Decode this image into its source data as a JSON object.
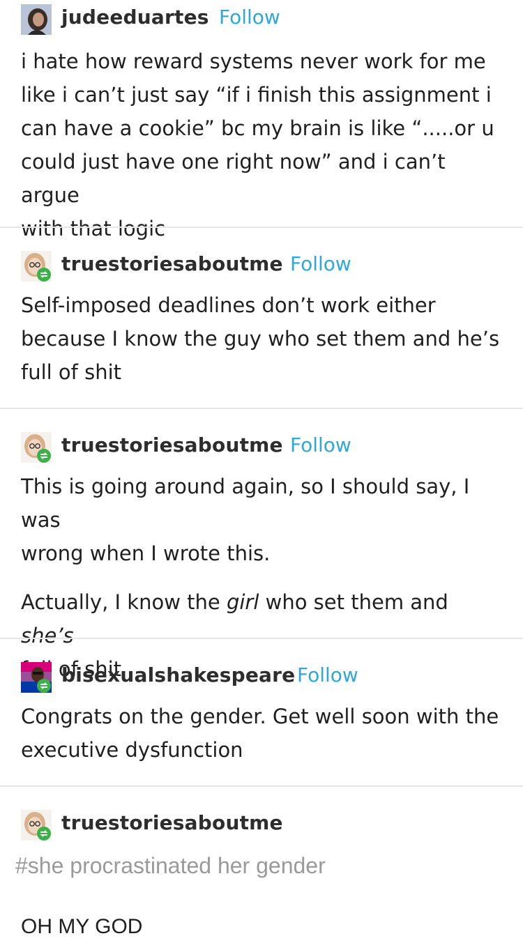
{
  "posts": [
    {
      "username": "judeeduartes",
      "follow_label": "Follow",
      "paragraphs": [
        "i hate how reward systems never work for me like i can’t just say “if i finish this assignment i can have a cookie” bc my brain is like “.....or u could just have one right now” and i can’t argue with that logic"
      ],
      "lines": [
        "i hate how reward systems never work for me",
        "like i can’t just say “if i finish this assignment i",
        "can have a cookie” bc my brain is like “.....or u",
        "could just have one right now” and i can’t argue",
        "with that logic"
      ]
    },
    {
      "username": "truestoriesaboutme",
      "follow_label": "Follow",
      "lines": [
        "Self-imposed deadlines don’t work either",
        "because I know the guy who set them and he’s",
        "full of shit"
      ]
    },
    {
      "username": "truestoriesaboutme",
      "follow_label": "Follow",
      "lines_a": [
        "This is going around again, so I should say, I was",
        "wrong when I wrote this."
      ],
      "line_b1_pre": "Actually, I know the ",
      "line_b1_em1": "girl",
      "line_b1_mid": " who set them and ",
      "line_b1_em2": "she’s",
      "line_b2": "full of shit"
    },
    {
      "username": "bisexualshakespeare",
      "follow_label": "Follow",
      "lines": [
        "Congrats on the gender. Get well soon with the",
        "executive dysfunction"
      ]
    },
    {
      "username": "truestoriesaboutme",
      "tag": "#she procrastinated her gender",
      "text": "OH MY GOD"
    }
  ],
  "colors": {
    "follow": "#2fa8d8",
    "divider": "#e6e6e6",
    "tag": "#9a9a9a",
    "reblog_badge": "#3cb14a"
  }
}
